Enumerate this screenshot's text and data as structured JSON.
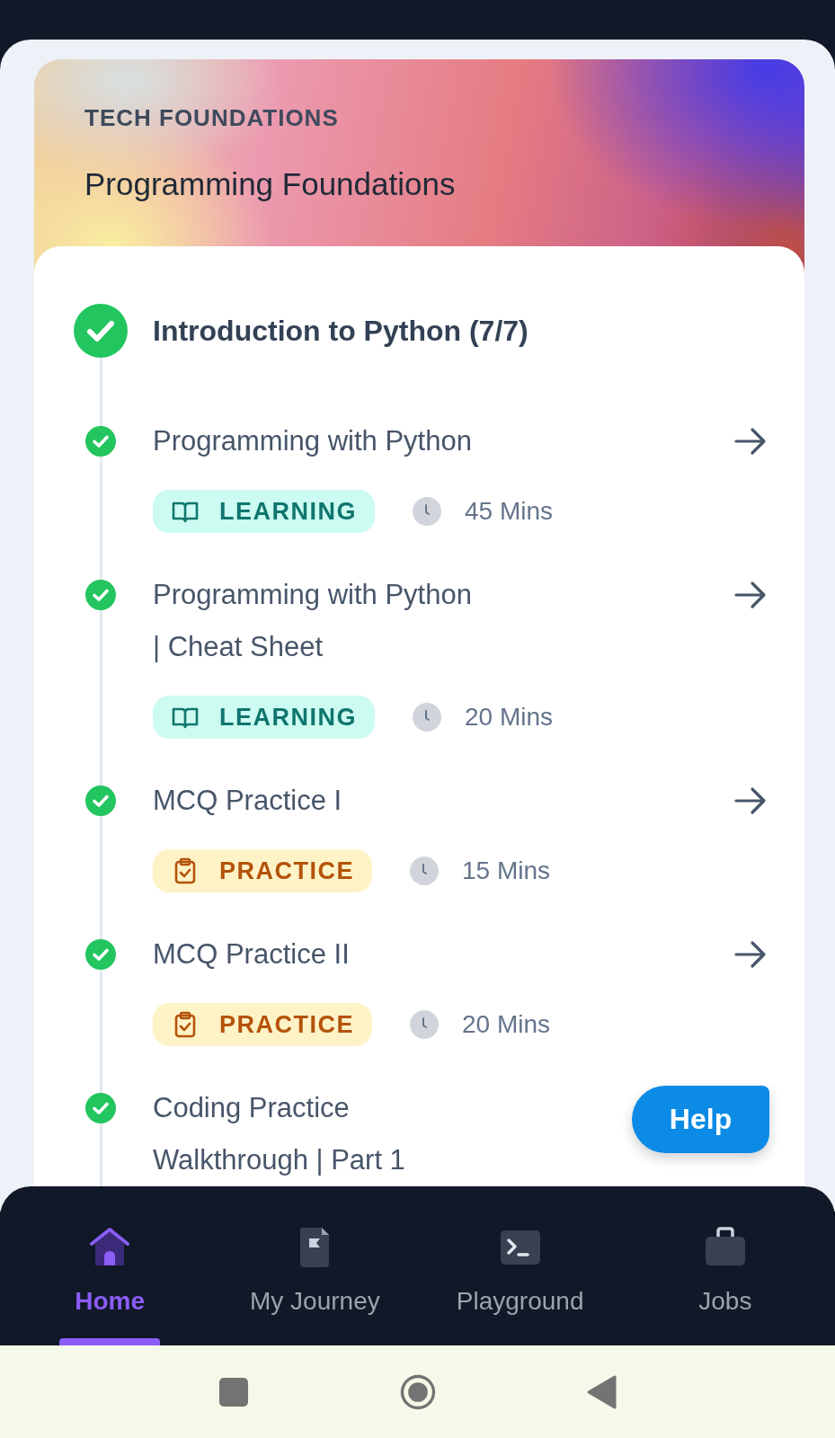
{
  "header": {
    "category": "TECH FOUNDATIONS",
    "title": "Programming Foundations"
  },
  "module": {
    "title": "Introduction to Python (7/7)",
    "completed": true
  },
  "items": [
    {
      "lines": [
        "Programming with Python"
      ],
      "completed": true,
      "kind": "learning",
      "tag": "LEARNING",
      "duration": "45 Mins"
    },
    {
      "lines": [
        "Programming with Python",
        "| Cheat Sheet"
      ],
      "completed": true,
      "kind": "learning",
      "tag": "LEARNING",
      "duration": "20 Mins"
    },
    {
      "lines": [
        "MCQ Practice I"
      ],
      "completed": true,
      "kind": "practice",
      "tag": "PRACTICE",
      "duration": "15 Mins"
    },
    {
      "lines": [
        "MCQ Practice II"
      ],
      "completed": true,
      "kind": "practice",
      "tag": "PRACTICE",
      "duration": "20 Mins"
    },
    {
      "lines": [
        "Coding Practice",
        "Walkthrough | Part 1"
      ],
      "completed": true
    }
  ],
  "help_button": "Help",
  "nav": [
    {
      "label": "Home",
      "kind": "home",
      "selected": true
    },
    {
      "label": "My Journey",
      "kind": "journey",
      "selected": false
    },
    {
      "label": "Playground",
      "kind": "playground",
      "selected": false
    },
    {
      "label": "Jobs",
      "kind": "jobs",
      "selected": false
    }
  ]
}
